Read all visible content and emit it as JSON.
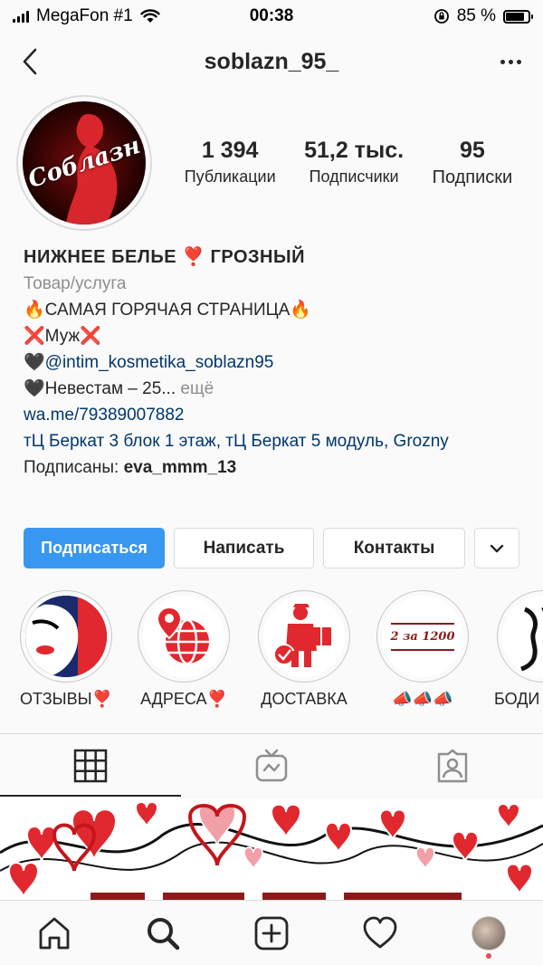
{
  "status_bar": {
    "carrier": "MegaFon #1",
    "time": "00:38",
    "battery": "85 %",
    "battery_level": 0.85
  },
  "header": {
    "username": "soblazn_95_"
  },
  "profile": {
    "avatar_logo": "Соблазн",
    "stats": [
      {
        "value": "1 394",
        "label": "Публикации"
      },
      {
        "value": "51,2 тыс.",
        "label": "Подписчики"
      },
      {
        "value": "95",
        "label": "Подписки"
      }
    ]
  },
  "bio": {
    "name": "НИЖНЕЕ БЕЛЬЕ ❣️ ГРОЗНЫЙ",
    "category": "Товар/услуга",
    "line1": "🔥САМАЯ ГОРЯЧАЯ СТРАНИЦА🔥",
    "line2": "❌Муж❌",
    "line3_prefix": "🖤",
    "line3_mention": "@intim_kosmetika_soblazn95",
    "line4": "🖤Невестам – 25...",
    "more": " ещё",
    "link": "wa.me/79389007882",
    "address": "тЦ Беркат 3 блок 1 этаж, тЦ Беркат 5 модуль, Grozny",
    "followed_by_prefix": "Подписаны: ",
    "followed_by_user": "eva_mmm_13"
  },
  "actions": {
    "follow": "Подписаться",
    "message": "Написать",
    "contacts": "Контакты"
  },
  "highlights": [
    {
      "label": "ОТЗЫВЫ❣️"
    },
    {
      "label": "АДРЕСА❣️"
    },
    {
      "label": "ДОСТАВКА"
    },
    {
      "label": "📣📣📣",
      "cover_text": "2 за 1200"
    },
    {
      "label": "БОДИ"
    }
  ],
  "colors": {
    "follow_button": "#3897f0",
    "link": "#00376b",
    "muted": "#8e8e8e",
    "highlight_red": "#e0282e"
  }
}
